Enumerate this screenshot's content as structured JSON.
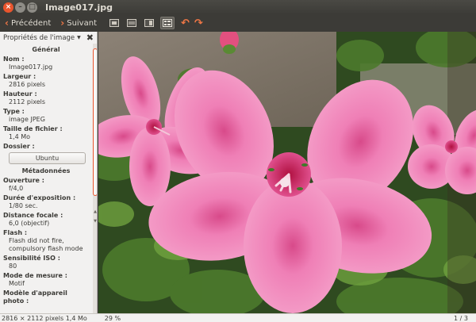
{
  "window": {
    "title": "Image017.jpg",
    "close_glyph": "×",
    "min_glyph": "–",
    "max_glyph": "□"
  },
  "toolbar": {
    "prev_label": "Précédent",
    "next_label": "Suivant",
    "prev_icon": "arrow-left-icon",
    "next_icon": "arrow-right-icon",
    "rotate_left_icon": "rotate-left-icon",
    "rotate_right_icon": "rotate-right-icon"
  },
  "sidebar": {
    "header_label": "Propriétés de l'image",
    "close_glyph": "✖",
    "general": {
      "title": "Général",
      "name_label": "Nom :",
      "name_value": "Image017.jpg",
      "width_label": "Largeur :",
      "width_value": "2816 pixels",
      "height_label": "Hauteur :",
      "height_value": "2112 pixels",
      "type_label": "Type :",
      "type_value": "image JPEG",
      "size_label": "Taille de fichier :",
      "size_value": "1,4 Mo",
      "folder_label": "Dossier :",
      "folder_button": "Ubuntu"
    },
    "metadata": {
      "title": "Métadonnées",
      "aperture_label": "Ouverture :",
      "aperture_value": "f/4,0",
      "exposure_label": "Durée d'exposition :",
      "exposure_value": "1/80 sec.",
      "focal_label": "Distance focale :",
      "focal_value": "6,0 (objectif)",
      "flash_label": "Flash :",
      "flash_value": "Flash did not fire, compulsory flash mode",
      "iso_label": "Sensibilité ISO :",
      "iso_value": "80",
      "metering_label": "Mode de mesure :",
      "metering_value": "Motif",
      "camera_label": "Modèle d'appareil photo :"
    }
  },
  "status": {
    "dimensions": "2816 × 2112 pixels  1,4 Mo",
    "zoom": "29 %",
    "count": "1 / 3"
  },
  "colors": {
    "accent": "#f07746",
    "title_bar": "#3c3b37",
    "panel_bg": "#f2f1f0",
    "flower_pink": "#ee86b8"
  }
}
